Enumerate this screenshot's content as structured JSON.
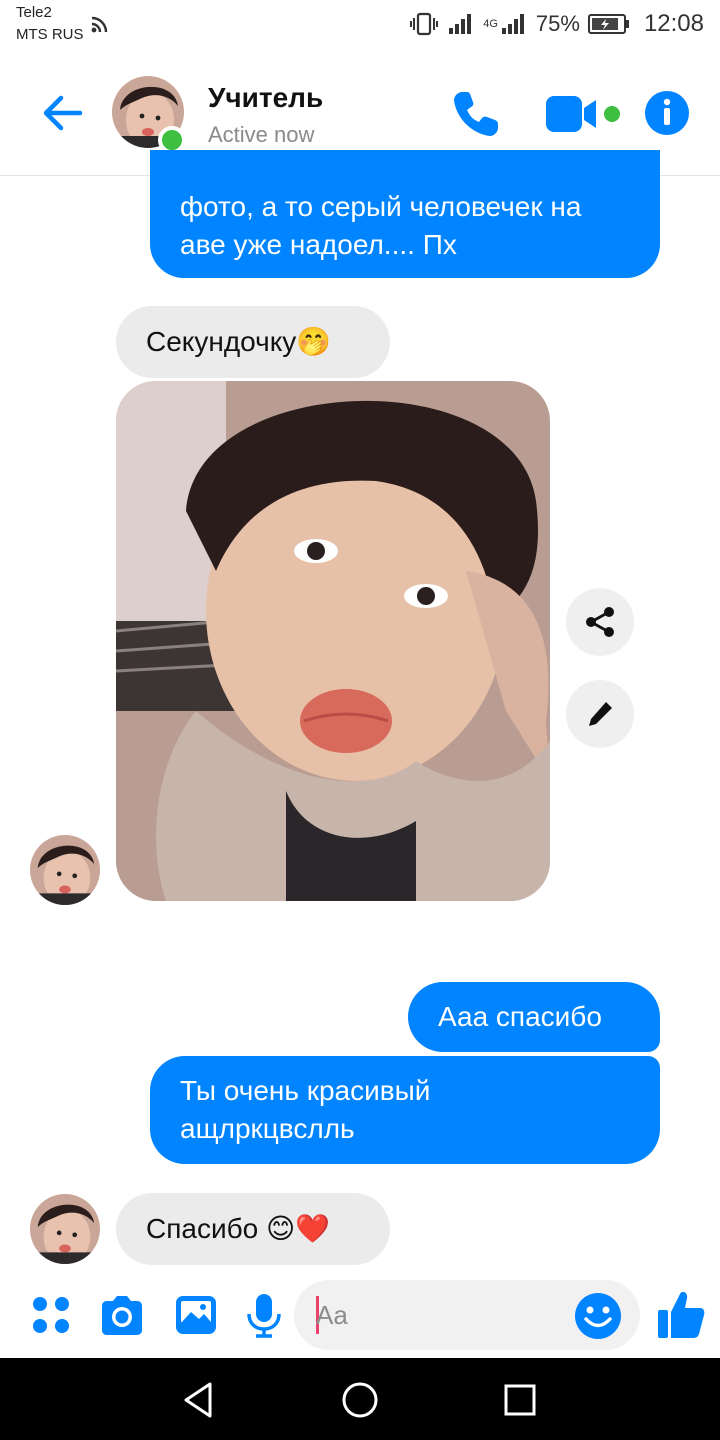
{
  "status_bar": {
    "carrier1": "Tele2",
    "carrier2": "MTS RUS",
    "network": "4G",
    "battery": "75%",
    "time": "12:08"
  },
  "header": {
    "name": "Учитель",
    "status": "Active now",
    "icons": [
      "back-arrow-icon",
      "phone-icon",
      "video-camera-icon",
      "info-icon"
    ]
  },
  "messages": [
    {
      "side": "outgoing",
      "text": "фото, а то серый человечек на\nаве уже надоел.... Пх"
    },
    {
      "side": "incoming",
      "text": "Секундочку🤭"
    },
    {
      "side": "incoming",
      "type": "photo"
    },
    {
      "side": "outgoing",
      "text": "Ааа спасибо"
    },
    {
      "side": "outgoing",
      "text": "Ты очень красивый\nащлркцвслль"
    },
    {
      "side": "incoming",
      "text": "Спасибо 😊❤️"
    }
  ],
  "composer": {
    "placeholder": "Aa",
    "icons": [
      "more-icon",
      "camera-icon",
      "gallery-icon",
      "microphone-icon",
      "emoji-icon",
      "thumbs-up-icon"
    ]
  },
  "nav": {
    "icons": [
      "nav-back-icon",
      "nav-home-icon",
      "nav-recents-icon"
    ]
  },
  "colors": {
    "accent": "#0084ff",
    "incoming_bubble": "#ebebeb",
    "online": "#3fbf3f"
  }
}
